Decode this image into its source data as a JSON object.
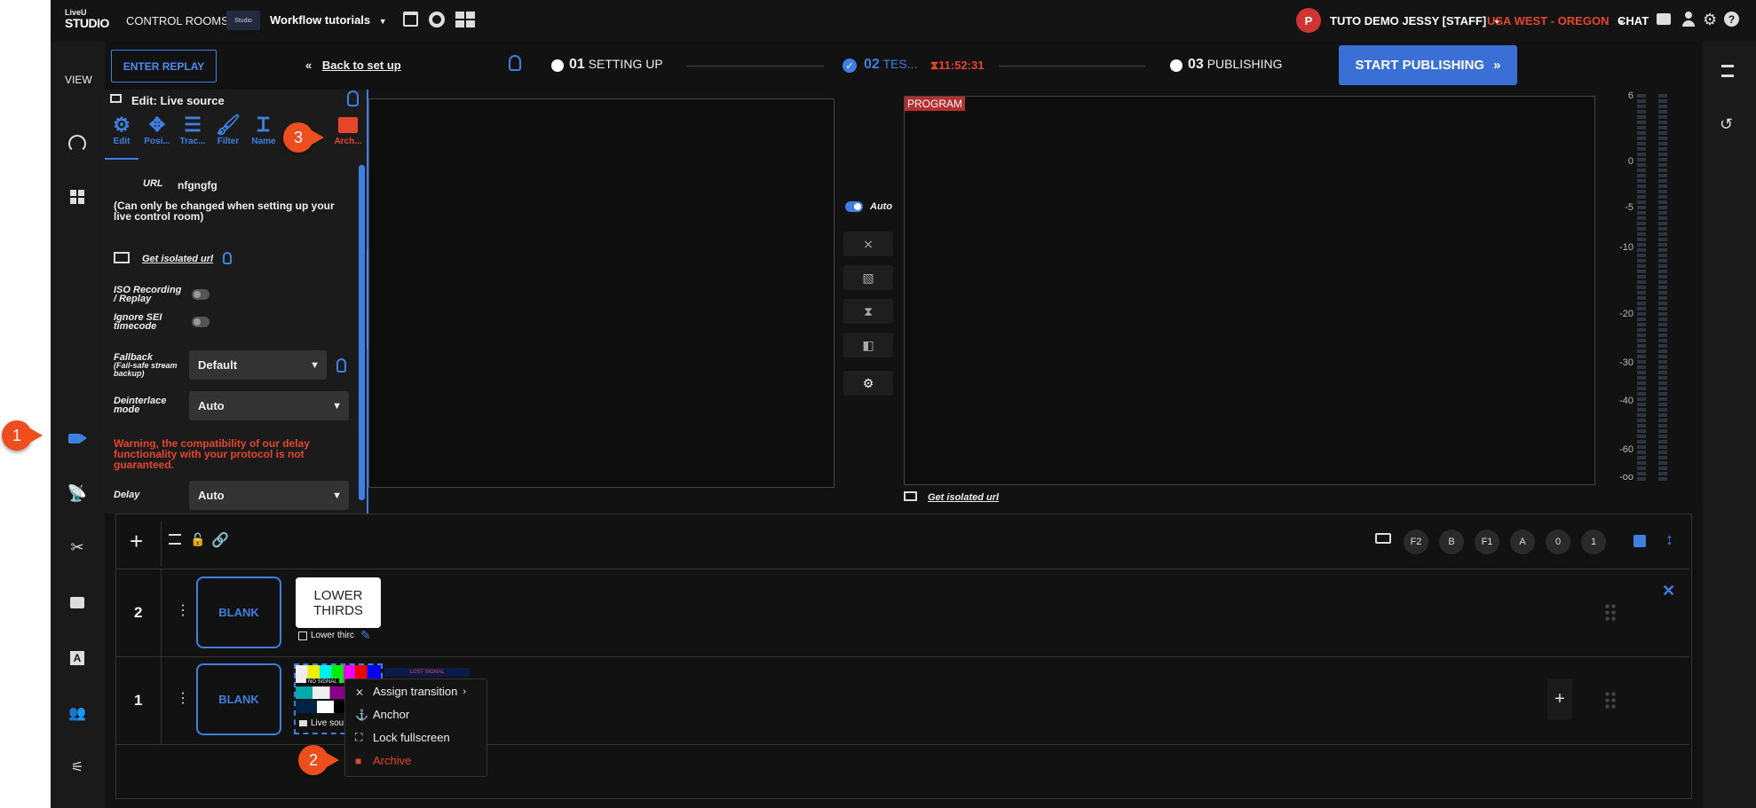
{
  "header": {
    "logo_top": "LiveU",
    "logo_bottom": "STUDIO",
    "control_rooms": "CONTROL ROOMS",
    "workflow_thumb": "Studio",
    "workflow": "Workflow tutorials",
    "user_initial": "P",
    "user": "TUTO DEMO JESSY [STAFF]",
    "region": "USA WEST - OREGON",
    "chat": "CHAT"
  },
  "leftrail": {
    "view": "VIEW"
  },
  "topnav": {
    "enter_replay": "ENTER REPLAY",
    "back": "Back to set up",
    "step1_num": "01",
    "step1": "SETTING UP",
    "step2_num": "02",
    "step2": "TES...",
    "timer": "11:52:31",
    "step3_num": "03",
    "step3": "PUBLISHING",
    "start_publishing": "START PUBLISHING"
  },
  "panel": {
    "title": "Edit: Live source",
    "tabs": [
      {
        "label": "Edit"
      },
      {
        "label": "Posi..."
      },
      {
        "label": "Trac..."
      },
      {
        "label": "Filter"
      },
      {
        "label": "Name"
      },
      {
        "label": "Arch..."
      }
    ],
    "url_label": "URL",
    "url_value": "nfgngfg",
    "url_note": "(Can only be changed when setting up your live control room)",
    "isolated_url": "Get isolated url",
    "iso_label": "ISO Recording / Replay",
    "sei_label": "Ignore SEI timecode",
    "fallback_label": "Fallback",
    "fallback_sub": "(Fail-safe stream backup)",
    "fallback_value": "Default",
    "deinterlace_label": "Deinterlace mode",
    "deinterlace_value": "Auto",
    "warning": "Warning, the compatibility of our delay functionality with your protocol is not guaranteed.",
    "delay_label": "Delay",
    "delay_value": "Auto"
  },
  "program": {
    "badge": "PROGRAM",
    "auto": "Auto",
    "isolated_url": "Get isolated url"
  },
  "meter_scale": [
    "6",
    "0",
    "-5",
    "-10",
    "-20",
    "-30",
    "-40",
    "-60",
    "-oo"
  ],
  "timeline": {
    "pills": [
      "F2",
      "B",
      "F1",
      "A",
      "0",
      "1"
    ],
    "rows": [
      {
        "num": "2",
        "blank": "BLANK",
        "thumb_text": "LOWER THIRDS",
        "caption": "Lower thirc"
      },
      {
        "num": "1",
        "blank": "BLANK",
        "caption": "Live sou",
        "nosignal": "NO SIGNAL",
        "lost": "LOST SIGNAL"
      }
    ]
  },
  "context_menu": {
    "items": [
      {
        "label": "Assign transition"
      },
      {
        "label": "Anchor"
      },
      {
        "label": "Lock fullscreen"
      },
      {
        "label": "Archive"
      }
    ]
  },
  "callouts": {
    "c1": "1",
    "c2": "2",
    "c3": "3"
  },
  "colors": {
    "accent": "#3f7fe0",
    "danger": "#e5452b",
    "callout": "#ee4d1e"
  }
}
